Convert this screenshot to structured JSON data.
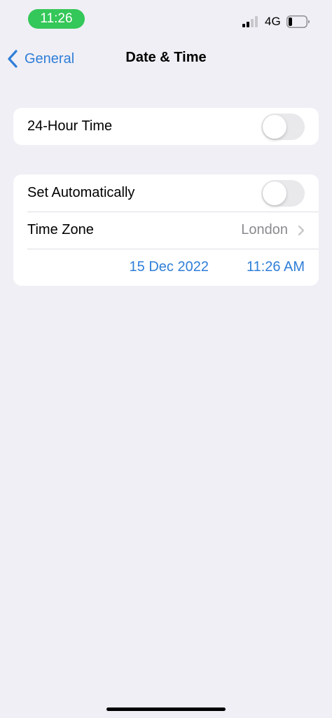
{
  "status_bar": {
    "time": "11:26",
    "network": "4G",
    "signal_icon": "cellular-signal-icon",
    "battery_icon": "battery-icon"
  },
  "nav": {
    "back_label": "General",
    "title": "Date & Time"
  },
  "settings": {
    "hour24": {
      "label": "24-Hour Time",
      "enabled": false
    },
    "set_automatically": {
      "label": "Set Automatically",
      "enabled": false
    },
    "time_zone": {
      "label": "Time Zone",
      "value": "London"
    },
    "date": "15 Dec 2022",
    "time": "11:26 AM"
  },
  "colors": {
    "accent": "#2f7ed8",
    "status_pill": "#34c759",
    "background": "#f0eff5"
  }
}
